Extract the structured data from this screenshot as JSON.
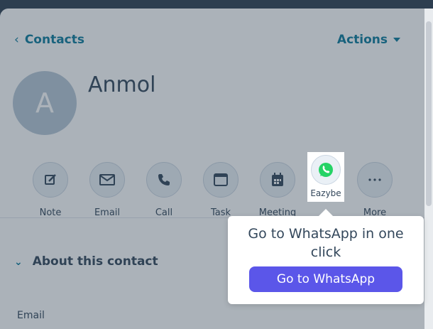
{
  "header": {
    "back_label": "Contacts",
    "actions_label": "Actions"
  },
  "contact": {
    "initial": "A",
    "name": "Anmol"
  },
  "actions": [
    {
      "label": "Note",
      "icon": "note-icon"
    },
    {
      "label": "Email",
      "icon": "email-icon"
    },
    {
      "label": "Call",
      "icon": "phone-icon"
    },
    {
      "label": "Task",
      "icon": "task-icon"
    },
    {
      "label": "Meeting",
      "icon": "calendar-icon"
    },
    {
      "label": "Eazybe",
      "icon": "whatsapp-icon"
    },
    {
      "label": "More",
      "icon": "more-icon"
    }
  ],
  "about": {
    "title": "About this contact",
    "email_label": "Email"
  },
  "popover": {
    "text": "Go to WhatsApp in one click",
    "button_label": "Go to WhatsApp"
  },
  "colors": {
    "accent": "#0b7a9b",
    "button": "#5b56e9",
    "whatsapp": "#25d366"
  }
}
